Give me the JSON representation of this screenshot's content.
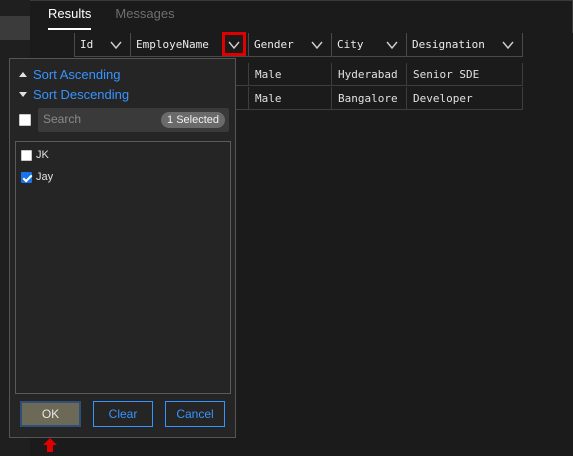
{
  "tabs": [
    {
      "label": "Results",
      "active": true
    },
    {
      "label": "Messages",
      "active": false
    }
  ],
  "grid": {
    "columns": [
      "Id",
      "EmployeName",
      "Gender",
      "City",
      "Designation"
    ],
    "rows": [
      {
        "gender": "Male",
        "city": "Hyderabad",
        "designation": "Senior SDE"
      },
      {
        "gender": "Male",
        "city": "Bangalore",
        "designation": "Developer"
      }
    ],
    "highlighted_filter_column": "EmployeName"
  },
  "filter_popup": {
    "sort_ascending": "Sort Ascending",
    "sort_descending": "Sort Descending",
    "search_placeholder": "Search",
    "selected_badge": "1 Selected",
    "items": [
      {
        "label": "JK",
        "checked": false
      },
      {
        "label": "Jay",
        "checked": true
      }
    ],
    "buttons": {
      "ok": "OK",
      "clear": "Clear",
      "cancel": "Cancel"
    }
  },
  "colors": {
    "accent": "#3794ff",
    "highlight_border": "#e00000",
    "background": "#1b1b1b",
    "popup_bg": "#252526"
  },
  "icons": {
    "column_filter": "chevron-down-icon",
    "sort_up": "triangle-up-icon",
    "sort_down": "triangle-down-icon",
    "pointer": "red-up-arrow-icon"
  }
}
